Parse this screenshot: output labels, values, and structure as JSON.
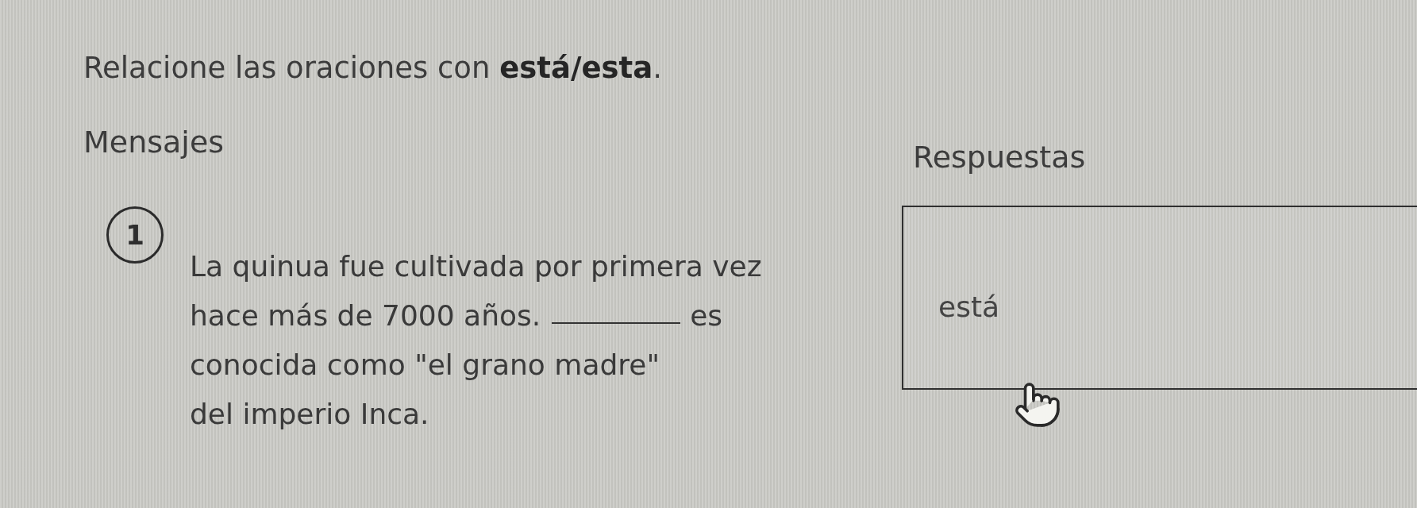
{
  "instruction": "Relacione las oraciones con **está/esta**.",
  "messages": {
    "heading": "Mensajes",
    "items": [
      {
        "number": "1",
        "lines": [
          [
            {
              "kind": "text",
              "text": "La quinua fue cultivada por primera vez"
            }
          ],
          [
            {
              "kind": "text",
              "text": "hace más de 7000 años."
            },
            {
              "kind": "blank"
            },
            {
              "kind": "text",
              "text": "es"
            }
          ],
          [
            {
              "kind": "text",
              "text": "conocida como \"el grano madre\""
            }
          ],
          [
            {
              "kind": "text",
              "text": "del imperio Inca."
            }
          ]
        ]
      }
    ]
  },
  "answers": {
    "heading": "Respuestas",
    "items": [
      {
        "text": "está"
      }
    ]
  }
}
